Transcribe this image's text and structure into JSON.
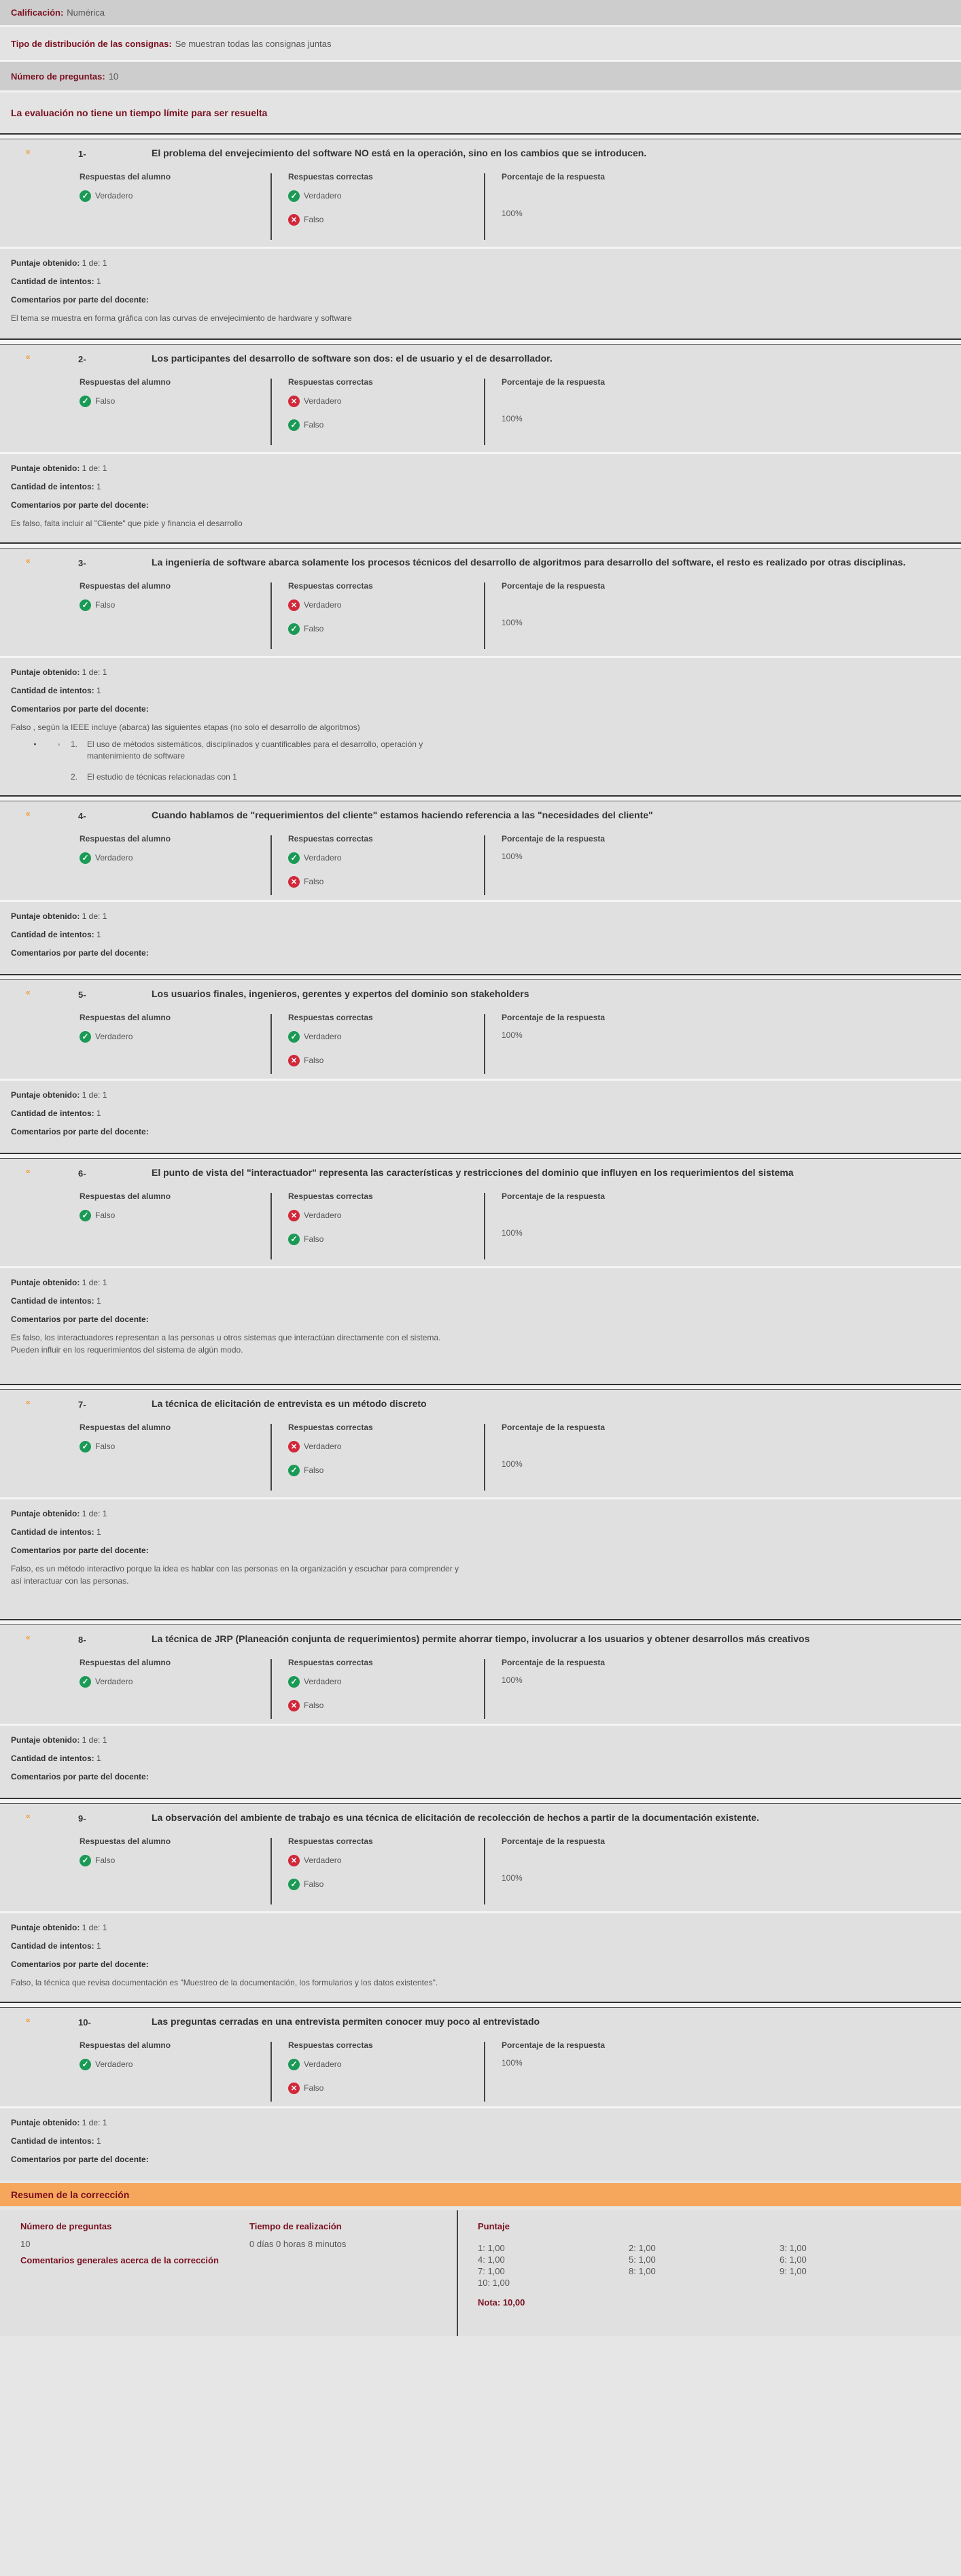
{
  "header": {
    "calificacion_label": "Calificación:",
    "calificacion_value": "Numérica",
    "tipo_label": "Tipo de distribución de las consignas:",
    "tipo_value": "Se muestran todas las consignas juntas",
    "numero_label": "Número de preguntas:",
    "numero_value": "10",
    "notice": "La evaluación no tiene un tiempo límite para ser resuelta"
  },
  "labels": {
    "col_alumno": "Respuestas del alumno",
    "col_correctas": "Respuestas correctas",
    "col_porcentaje": "Porcentaje de la respuesta",
    "puntaje": "Puntaje obtenido:",
    "intentos": "Cantidad de intentos:",
    "comentarios": "Comentarios por parte del docente:",
    "mark": "«",
    "verdadero": "Verdadero",
    "falso": "Falso",
    "pct": "100%"
  },
  "questions": [
    {
      "num": "1-",
      "text": "El problema del envejecimiento del software NO está en la operación, sino en los cambios que se introducen.",
      "puntaje": "1 de: 1",
      "intentos": "1",
      "comment": "El tema se muestra en forma gráfica con las curvas de envejecimiento de hardware y software"
    },
    {
      "num": "2-",
      "text": "Los participantes del desarrollo de software son dos: el de usuario y el de desarrollador.",
      "puntaje": "1 de: 1",
      "intentos": "1",
      "comment": "Es falso, falta incluir al \"Cliente\" que pide y financia el desarrollo"
    },
    {
      "num": "3-",
      "text": "La ingeniería de software abarca solamente los procesos técnicos del desarrollo de algoritmos para desarrollo del software, el resto es realizado por otras disciplinas.",
      "puntaje": "1 de: 1",
      "intentos": "1",
      "comment": "Falso , según la IEEE incluye (abarca)  las siguientes etapas (no solo el desarrollo de algoritmos)",
      "bullets": [
        "•",
        "◦"
      ],
      "items": [
        {
          "n": "1.",
          "t": "El uso de métodos sistemáticos, disciplinados y cuantificables para el desarrollo, operación y mantenimiento de software"
        },
        {
          "n": "2.",
          "t": "El estudio de técnicas relacionadas con 1"
        }
      ]
    },
    {
      "num": "4-",
      "text": "Cuando hablamos de \"requerimientos del cliente\" estamos haciendo referencia a las \"necesidades del cliente\"",
      "puntaje": "1 de: 1",
      "intentos": "1",
      "comment": ""
    },
    {
      "num": "5-",
      "text": "Los usuarios finales,  ingenieros, gerentes y expertos del dominio son stakeholders",
      "puntaje": "1 de: 1",
      "intentos": "1",
      "comment": ""
    },
    {
      "num": "6-",
      "text": "El punto de vista del \"interactuador\" representa las características y restricciones del dominio que influyen en los requerimientos del sistema",
      "puntaje": "1 de: 1",
      "intentos": "1",
      "comment": "Es falso, los interactuadores representan a las personas u otros sistemas que interactúan directamente con el sistema.",
      "comment2": "Pueden influir en los requerimientos del sistema de algún modo."
    },
    {
      "num": "7-",
      "text": "La técnica de elicitación de entrevista es un método discreto",
      "puntaje": "1 de: 1",
      "intentos": "1",
      "comment": "Falso, es un método interactivo porque la idea es hablar con las personas en la organización y escuchar para comprender y",
      "comment2": "así interactuar con las personas."
    },
    {
      "num": "8-",
      "text": "La técnica de JRP (Planeación conjunta de requerimientos) permite ahorrar tiempo, involucrar a los usuarios y obtener desarrollos más creativos",
      "puntaje": "1 de: 1",
      "intentos": "1",
      "comment": ""
    },
    {
      "num": "9-",
      "text": "La observación del ambiente de trabajo es una técnica de elicitación de recolección de hechos a partir de la documentación existente.",
      "puntaje": "1 de: 1",
      "intentos": "1",
      "comment": "Falso, la técnica que revisa documentación es \"Muestreo de la documentación, los formularios y los datos existentes\"."
    },
    {
      "num": "10-",
      "text": "Las preguntas cerradas en una entrevista permiten conocer muy poco al entrevistado",
      "puntaje": "1 de: 1",
      "intentos": "1",
      "comment": ""
    }
  ],
  "summary": {
    "title": "Resumen de la corrección",
    "numero_label": "Número de preguntas",
    "numero_value": "10",
    "tiempo_label": "Tiempo de realización",
    "tiempo_value": "0 días 0 horas 8 minutos",
    "comentarios_label": "Comentarios generales acerca de la corrección",
    "puntaje_label": "Puntaje",
    "scores": [
      "1: 1,00",
      "2: 1,00",
      "3: 1,00",
      "4: 1,00",
      "5: 1,00",
      "6: 1,00",
      "7: 1,00",
      "8: 1,00",
      "9: 1,00",
      "10: 1,00"
    ],
    "nota": "Nota: 10,00"
  }
}
